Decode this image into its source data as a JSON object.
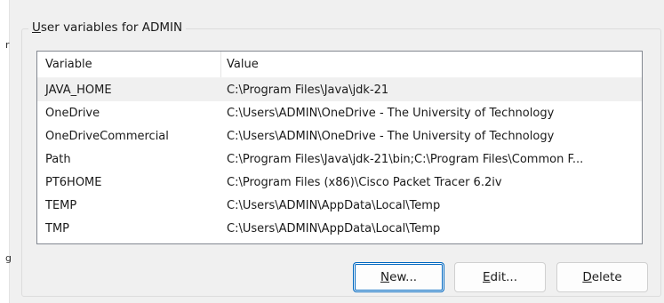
{
  "left_edge": {
    "fragments": [
      "r",
      "g"
    ]
  },
  "user_variables": {
    "title_mnemonic": "U",
    "title_rest": "ser variables for ADMIN",
    "columns": {
      "variable": "Variable",
      "value": "Value"
    },
    "rows": [
      {
        "variable": "JAVA_HOME",
        "value": "C:\\Program Files\\Java\\jdk-21",
        "selected": true
      },
      {
        "variable": "OneDrive",
        "value": "C:\\Users\\ADMIN\\OneDrive - The University of Technology",
        "selected": false
      },
      {
        "variable": "OneDriveCommercial",
        "value": "C:\\Users\\ADMIN\\OneDrive - The University of Technology",
        "selected": false
      },
      {
        "variable": "Path",
        "value": "C:\\Program Files\\Java\\jdk-21\\bin;C:\\Program Files\\Common F...",
        "selected": false
      },
      {
        "variable": "PT6HOME",
        "value": "C:\\Program Files (x86)\\Cisco Packet Tracer 6.2iv",
        "selected": false
      },
      {
        "variable": "TEMP",
        "value": "C:\\Users\\ADMIN\\AppData\\Local\\Temp",
        "selected": false
      },
      {
        "variable": "TMP",
        "value": "C:\\Users\\ADMIN\\AppData\\Local\\Temp",
        "selected": false
      }
    ]
  },
  "buttons": {
    "new": {
      "mnemonic": "N",
      "rest": "ew..."
    },
    "edit": {
      "mnemonic": "E",
      "rest": "dit..."
    },
    "delete": {
      "mnemonic": "D",
      "rest": "elete"
    }
  },
  "colors": {
    "accent": "#0067c0",
    "selected_row": "#f0f0f0",
    "background": "#f0f0f0"
  }
}
